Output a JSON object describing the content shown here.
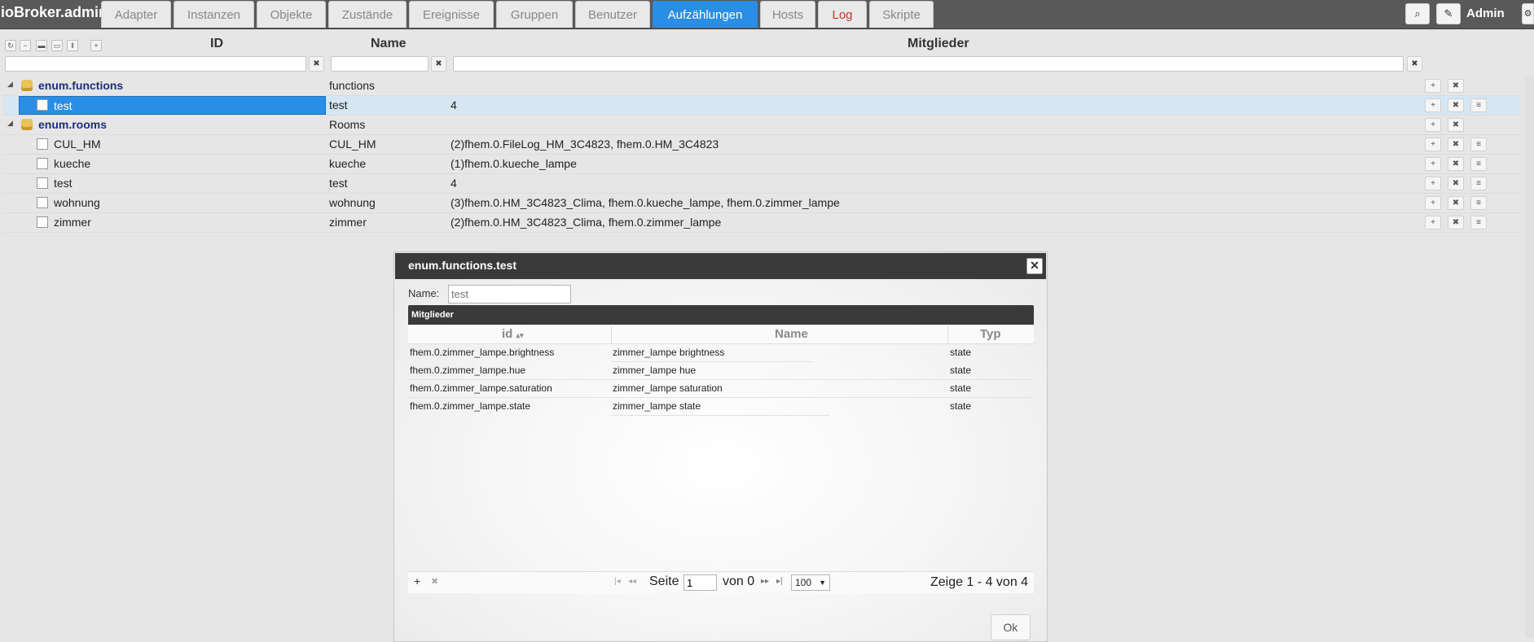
{
  "app": {
    "title": "ioBroker.admin",
    "user": "Admin"
  },
  "tabs": [
    {
      "label": "Adapter"
    },
    {
      "label": "Instanzen"
    },
    {
      "label": "Objekte"
    },
    {
      "label": "Zustände"
    },
    {
      "label": "Ereignisse"
    },
    {
      "label": "Gruppen"
    },
    {
      "label": "Benutzer"
    },
    {
      "label": "Aufzählungen",
      "active": true
    },
    {
      "label": "Hosts"
    },
    {
      "label": "Log"
    },
    {
      "label": "Skripte"
    }
  ],
  "columns": {
    "id": "ID",
    "name": "Name",
    "members": "Mitglieder"
  },
  "tree": [
    {
      "id": "enum.functions",
      "name": "functions",
      "members": "",
      "folder": true
    },
    {
      "id": "test",
      "name": "test",
      "members": "4",
      "selected": true
    },
    {
      "id": "enum.rooms",
      "name": "Rooms",
      "members": "",
      "folder": true
    },
    {
      "id": "CUL_HM",
      "name": "CUL_HM",
      "members": "(2)fhem.0.FileLog_HM_3C4823, fhem.0.HM_3C4823"
    },
    {
      "id": "kueche",
      "name": "kueche",
      "members": "(1)fhem.0.kueche_lampe"
    },
    {
      "id": "test",
      "name": "test",
      "members": "4"
    },
    {
      "id": "wohnung",
      "name": "wohnung",
      "members": "(3)fhem.0.HM_3C4823_Clima, fhem.0.kueche_lampe, fhem.0.zimmer_lampe"
    },
    {
      "id": "zimmer",
      "name": "zimmer",
      "members": "(2)fhem.0.HM_3C4823_Clima, fhem.0.zimmer_lampe"
    }
  ],
  "dialog": {
    "title": "enum.functions.test",
    "name_label": "Name:",
    "name_placeholder": "test",
    "grid_title": "Mitglieder",
    "grid_headers": {
      "id": "id",
      "name": "Name",
      "type": "Typ"
    },
    "rows": [
      {
        "id": "fhem.0.zimmer_lampe.brightness",
        "name": "zimmer_lampe brightness",
        "type": "state"
      },
      {
        "id": "fhem.0.zimmer_lampe.hue",
        "name": "zimmer_lampe hue",
        "type": "state"
      },
      {
        "id": "fhem.0.zimmer_lampe.saturation",
        "name": "zimmer_lampe saturation",
        "type": "state"
      },
      {
        "id": "fhem.0.zimmer_lampe.state",
        "name": "zimmer_lampe state",
        "type": "state"
      }
    ],
    "pager": {
      "page_label": "Seite",
      "page_value": "1",
      "page_of": "von 0",
      "rows_per_page": "100",
      "info": "Zeige 1 - 4 von 4"
    },
    "ok_label": "Ok"
  },
  "colors": {
    "accent": "#2a8ee6",
    "topbar": "#595959",
    "log_tab": "#d0322a",
    "folder_text": "#1d2f7a"
  }
}
